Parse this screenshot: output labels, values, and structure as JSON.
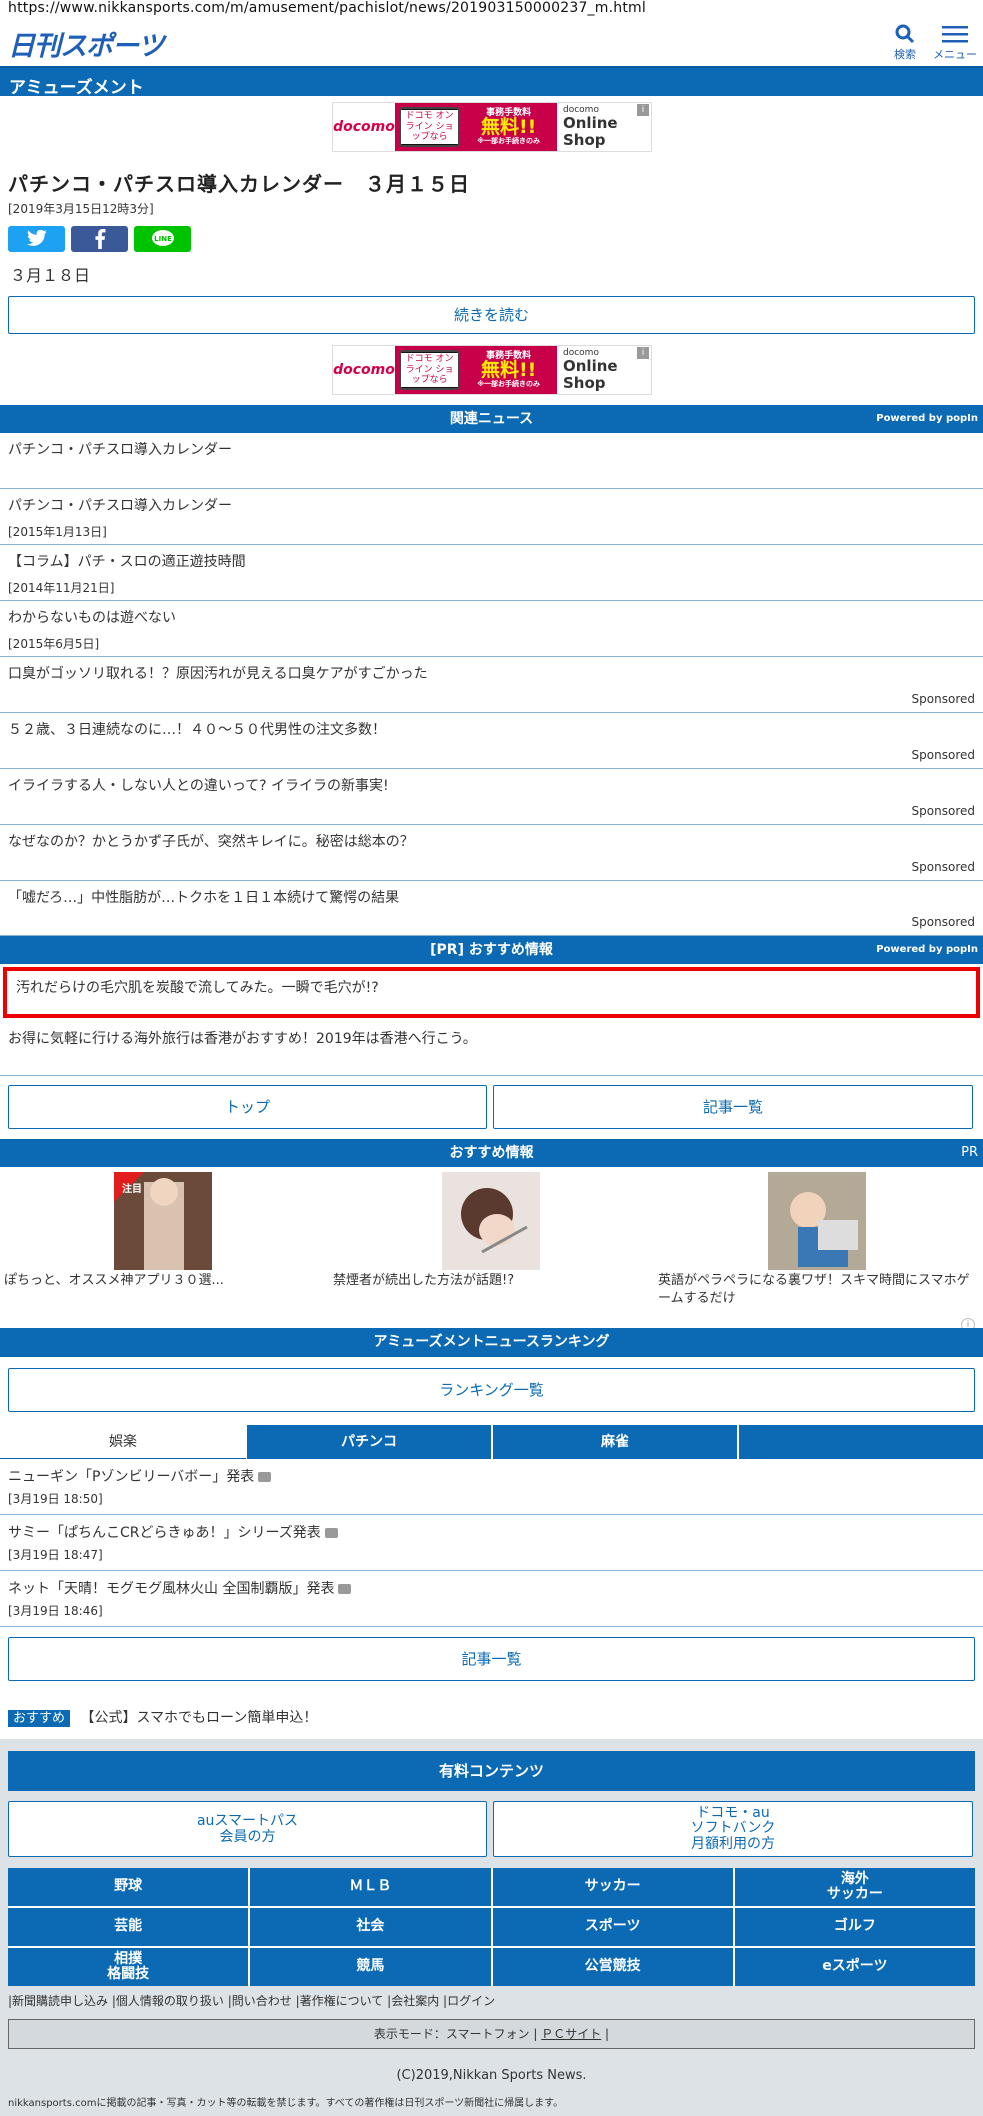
{
  "header": {
    "url": "https://www.nikkansports.com/m/amusement/pachislot/news/201903150000237_m.html",
    "logo": "日刊スポーツ",
    "search": "検索",
    "menu": "メニュー"
  },
  "section": "アミューズメント",
  "ad": {
    "brand": "docomo",
    "phone": "ドコモ オンライン ショップなら",
    "fee": "事務手数料",
    "free": "無料!!",
    "note": "※一部お手続きのみ",
    "shop_top": "docomo",
    "shop": "Online Shop",
    "info": "i"
  },
  "article": {
    "title": "パチンコ・パチスロ導入カレンダー　３月１５日",
    "date": "[2019年3月15日12時3分]",
    "body": "３月１８日",
    "read_more": "続きを読む",
    "share": {
      "line": "LINE"
    }
  },
  "related": {
    "title": "関連ニュース",
    "powered": "Powered by popIn",
    "items": [
      {
        "text": "パチンコ・パチスロ導入カレンダー",
        "date": ""
      },
      {
        "text": "パチンコ・パチスロ導入カレンダー",
        "date": "[2015年1月13日]"
      },
      {
        "text": "【コラム】パチ・スロの適正遊技時間",
        "date": "[2014年11月21日]"
      },
      {
        "text": "わからないものは遊べない",
        "date": "[2015年6月5日]"
      }
    ],
    "sponsored": [
      {
        "text": "口臭がゴッソリ取れる！？原因汚れが見える口臭ケアがすごかった",
        "label": "Sponsored"
      },
      {
        "text": "５２歳、３日連続なのに…！４０～５０代男性の注文多数！",
        "label": "Sponsored"
      },
      {
        "text": "イライラする人・しない人との違いって? イライラの新事実!",
        "label": "Sponsored"
      },
      {
        "text": "なぜなのか？かとうかず子氏が、突然キレイに。秘密は総本の？",
        "label": "Sponsored"
      },
      {
        "text": "「嘘だろ…」中性脂肪が…トクホを１日１本続けて驚愕の結果",
        "label": "Sponsored"
      }
    ]
  },
  "pr": {
    "title": "[PR] おすすめ情報",
    "powered": "Powered by popIn",
    "items": [
      "汚れだらけの毛穴肌を炭酸で流してみた。一瞬で毛穴が!?",
      "お得に気軽に行ける海外旅行は香港がおすすめ！2019年は香港へ行こう。"
    ]
  },
  "nav": {
    "top": "トップ",
    "list": "記事一覧"
  },
  "recommend": {
    "title": "おすすめ情報",
    "pr": "PR",
    "badge": "注目",
    "info": "i",
    "items": [
      "ぽちっと、オススメ神アプリ３０選...",
      "禁煙者が続出した方法が話題!?",
      "英語がペラペラになる裏ワザ！スキマ時間にスマホゲームするだけ"
    ]
  },
  "ranking": {
    "title": "アミューズメントニュースランキング",
    "button": "ランキング一覧",
    "tabs": [
      "娯楽",
      "パチンコ",
      "麻雀",
      ""
    ],
    "news": [
      {
        "text": "ニューギン「Pゾンビリーバボー」発表",
        "date": "[3月19日 18:50]"
      },
      {
        "text": "サミー「ぱちんこCRどらきゅあ！」シリーズ発表",
        "date": "[3月19日 18:47]"
      },
      {
        "text": "ネット「天晴！モグモグ風林火山 全国制覇版」発表",
        "date": "[3月19日 18:46]"
      }
    ],
    "list": "記事一覧"
  },
  "osusume": {
    "label": "おすすめ",
    "text": "【公式】スマホでもローン簡単申込！"
  },
  "paid": {
    "title": "有料コンテンツ",
    "au": "auスマートパス\n会員の方",
    "docomo": "ドコモ・au\nソフトバンク\n月額利用の方"
  },
  "categories": [
    "野球",
    "ＭＬＢ",
    "サッカー",
    "海外\nサッカー",
    "芸能",
    "社会",
    "スポーツ",
    "ゴルフ",
    "相撲\n格闘技",
    "競馬",
    "公営競技",
    "eスポーツ"
  ],
  "footer": {
    "links": [
      "新聞購読申し込み",
      "個人情報の取り扱い",
      "問い合わせ",
      "著作権について",
      "会社案内",
      "ログイン"
    ],
    "mode_label": "表示モード：スマートフォン",
    "pc": "ＰＣサイト",
    "copyright": "(C)2019,Nikkan Sports News.",
    "notice": "nikkansports.comに掲載の記事・写真・カット等の転載を禁じます。すべての著作権は日刊スポーツ新聞社に帰属します。"
  }
}
